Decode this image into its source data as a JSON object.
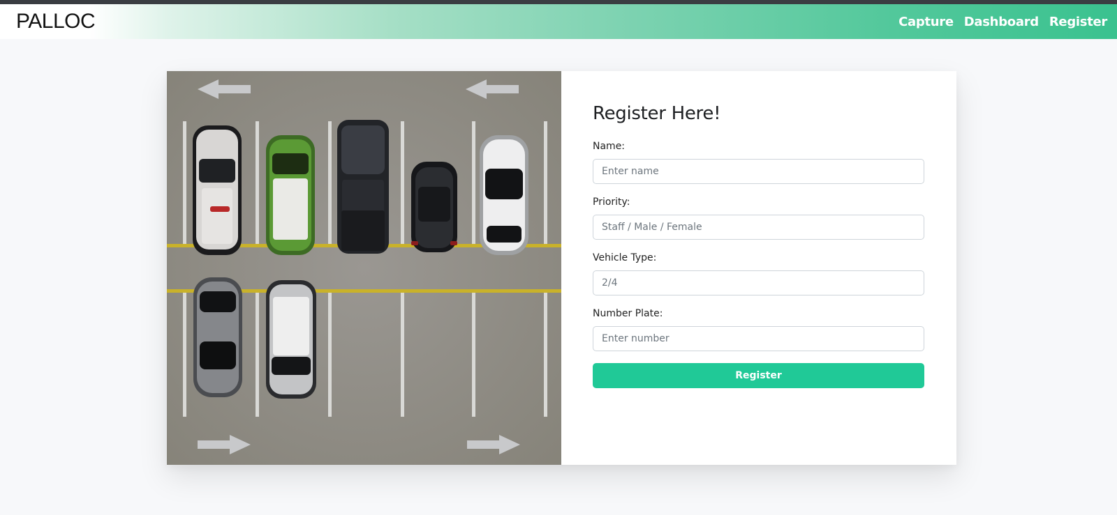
{
  "navbar": {
    "brand": "PALLOC",
    "links": [
      "Capture",
      "Dashboard",
      "Register"
    ]
  },
  "form": {
    "title": "Register Here!",
    "fields": [
      {
        "label": "Name:",
        "placeholder": "Enter name"
      },
      {
        "label": "Priority:",
        "placeholder": "Staff / Male / Female"
      },
      {
        "label": "Vehicle Type:",
        "placeholder": "2/4"
      },
      {
        "label": "Number Plate:",
        "placeholder": "Enter number"
      }
    ],
    "submit_label": "Register"
  },
  "image": {
    "icons": [
      "arrow-left-icon",
      "arrow-right-icon",
      "car-icon"
    ]
  },
  "colors": {
    "accent": "#20c997",
    "asphalt": "#8f8c87",
    "yellow_line": "#c9b22a"
  }
}
